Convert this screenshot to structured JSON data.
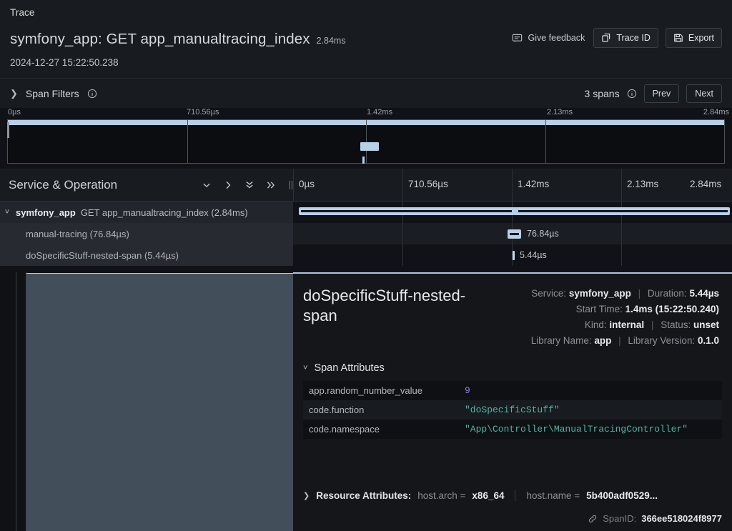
{
  "header": {
    "kicker": "Trace",
    "title": "symfony_app: GET app_manualtracing_index",
    "duration": "2.84ms",
    "timestamp": "2024-12-27 15:22:50.238",
    "feedback_label": "Give feedback",
    "trace_id_label": "Trace ID",
    "export_label": "Export"
  },
  "filters": {
    "title": "Span Filters",
    "spans_count": "3 spans",
    "prev_label": "Prev",
    "next_label": "Next"
  },
  "minimap": {
    "ticks": [
      "0µs",
      "710.56µs",
      "1.42ms",
      "2.13ms",
      "2.84ms"
    ]
  },
  "timeline": {
    "column_title": "Service & Operation",
    "ticks": [
      "0µs",
      "710.56µs",
      "1.42ms",
      "2.13ms",
      "2.84ms"
    ]
  },
  "spans": [
    {
      "service": "symfony_app",
      "operation": "GET app_manualtracing_index (2.84ms)",
      "bar_label": ""
    },
    {
      "service": "",
      "operation": "manual-tracing (76.84µs)",
      "bar_label": "76.84µs"
    },
    {
      "service": "",
      "operation": "doSpecificStuff-nested-span (5.44µs)",
      "bar_label": "5.44µs"
    }
  ],
  "detail": {
    "title": "doSpecificStuff-nested-span",
    "service_label": "Service:",
    "service_value": "symfony_app",
    "duration_label": "Duration:",
    "duration_value": "5.44µs",
    "start_time_label": "Start Time:",
    "start_time_value": "1.4ms (15:22:50.240)",
    "kind_label": "Kind:",
    "kind_value": "internal",
    "status_label": "Status:",
    "status_value": "unset",
    "library_name_label": "Library Name:",
    "library_name_value": "app",
    "library_version_label": "Library Version:",
    "library_version_value": "0.1.0",
    "attributes_title": "Span Attributes",
    "attributes": [
      {
        "key": "app.random_number_value",
        "value": "9",
        "kind": "num"
      },
      {
        "key": "code.function",
        "value": "\"doSpecificStuff\"",
        "kind": "str"
      },
      {
        "key": "code.namespace",
        "value": "\"App\\Controller\\ManualTracingController\"",
        "kind": "str"
      }
    ],
    "resource_attributes_label": "Resource Attributes:",
    "resource_attributes": [
      {
        "key": "host.arch =",
        "value": "x86_64"
      },
      {
        "key": "host.name =",
        "value": "5b400adf0529..."
      }
    ],
    "spanid_label": "SpanID:",
    "spanid_value": "366ee518024f8977"
  },
  "colors": {
    "accent_bar": "#b7d0e8",
    "panel_bg": "#181b1f",
    "app_bg": "#111217",
    "value_string": "#4db6a5",
    "value_number": "#8e7ee0"
  }
}
